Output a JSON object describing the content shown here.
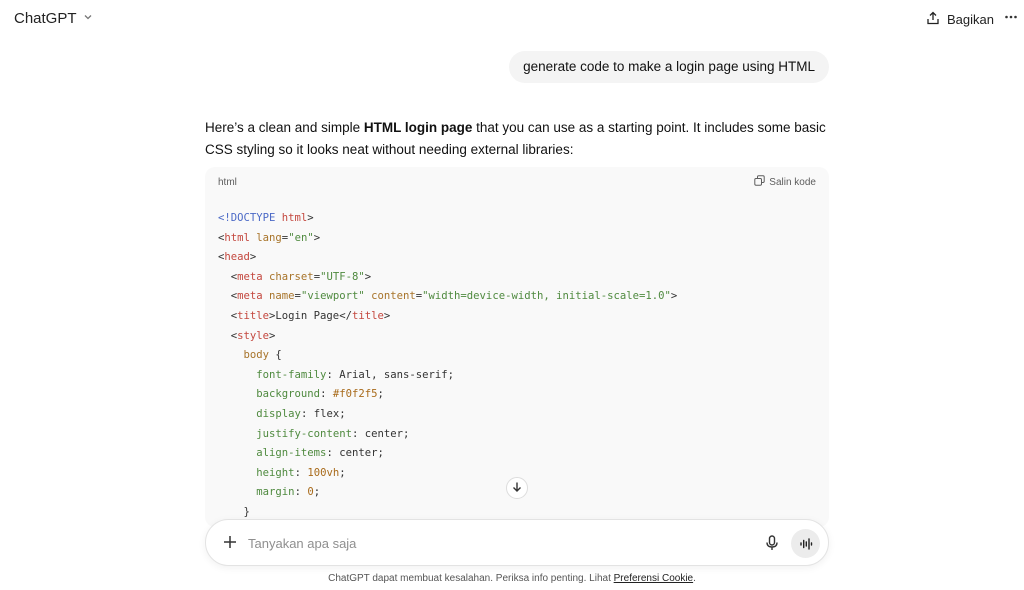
{
  "header": {
    "model_name": "ChatGPT",
    "share_label": "Bagikan",
    "more_label": "···"
  },
  "user_message": "generate code to make a login page using HTML",
  "assistant": {
    "intro_before_bold": "Here’s a clean and simple ",
    "intro_bold": "HTML login page",
    "intro_after_bold": " that you can use as a starting point. It includes some basic CSS styling so it looks neat without needing external libraries:"
  },
  "code_block": {
    "language": "html",
    "copy_label": "Salin kode",
    "lines": [
      [
        [
          "doc",
          "<!DOCTYPE "
        ],
        [
          "tag",
          "html"
        ],
        [
          "p",
          ">"
        ]
      ],
      [
        [
          "p",
          "<"
        ],
        [
          "tag",
          "html "
        ],
        [
          "attr",
          "lang"
        ],
        [
          "p",
          "="
        ],
        [
          "str",
          "\"en\""
        ],
        [
          "p",
          ">"
        ]
      ],
      [
        [
          "p",
          "<"
        ],
        [
          "tag",
          "head"
        ],
        [
          "p",
          ">"
        ]
      ],
      [
        [
          "p",
          "  <"
        ],
        [
          "tag",
          "meta "
        ],
        [
          "attr",
          "charset"
        ],
        [
          "p",
          "="
        ],
        [
          "str",
          "\"UTF-8\""
        ],
        [
          "p",
          ">"
        ]
      ],
      [
        [
          "p",
          "  <"
        ],
        [
          "tag",
          "meta "
        ],
        [
          "attr",
          "name"
        ],
        [
          "p",
          "="
        ],
        [
          "str",
          "\"viewport\""
        ],
        [
          "p",
          " "
        ],
        [
          "attr",
          "content"
        ],
        [
          "p",
          "="
        ],
        [
          "str",
          "\"width=device-width, initial-scale=1.0\""
        ],
        [
          "p",
          ">"
        ]
      ],
      [
        [
          "p",
          "  <"
        ],
        [
          "tag",
          "title"
        ],
        [
          "p",
          ">Login Page</"
        ],
        [
          "tag",
          "title"
        ],
        [
          "p",
          ">"
        ]
      ],
      [
        [
          "p",
          "  <"
        ],
        [
          "tag",
          "style"
        ],
        [
          "p",
          ">"
        ]
      ],
      [
        [
          "p",
          "    "
        ],
        [
          "sel",
          "body"
        ],
        [
          "p",
          " {"
        ]
      ],
      [
        [
          "p",
          "      "
        ],
        [
          "prop",
          "font-family"
        ],
        [
          "p",
          ": Arial, sans-serif;"
        ]
      ],
      [
        [
          "p",
          "      "
        ],
        [
          "prop",
          "background"
        ],
        [
          "p",
          ": "
        ],
        [
          "num",
          "#f0f2f5"
        ],
        [
          "p",
          ";"
        ]
      ],
      [
        [
          "p",
          "      "
        ],
        [
          "prop",
          "display"
        ],
        [
          "p",
          ": flex;"
        ]
      ],
      [
        [
          "p",
          "      "
        ],
        [
          "prop",
          "justify-content"
        ],
        [
          "p",
          ": center;"
        ]
      ],
      [
        [
          "p",
          "      "
        ],
        [
          "prop",
          "align-items"
        ],
        [
          "p",
          ": center;"
        ]
      ],
      [
        [
          "p",
          "      "
        ],
        [
          "prop",
          "height"
        ],
        [
          "p",
          ": "
        ],
        [
          "num",
          "100vh"
        ],
        [
          "p",
          ";"
        ]
      ],
      [
        [
          "p",
          "      "
        ],
        [
          "prop",
          "margin"
        ],
        [
          "p",
          ": "
        ],
        [
          "num",
          "0"
        ],
        [
          "p",
          ";"
        ]
      ],
      [
        [
          "p",
          "    }"
        ]
      ]
    ]
  },
  "composer": {
    "placeholder": "Tanyakan apa saja",
    "value": ""
  },
  "footer": {
    "text": "ChatGPT dapat membuat kesalahan. Periksa info penting. Lihat ",
    "link": "Preferensi Cookie",
    "suffix": "."
  },
  "icons": {
    "model_chevron": "chevron-down-icon",
    "share": "share-upload-icon",
    "more": "more-horizontal-icon",
    "copy": "copy-icon",
    "scroll_down": "arrow-down-icon",
    "plus": "plus-icon",
    "mic": "microphone-icon",
    "voice": "voice-waveform-icon"
  }
}
